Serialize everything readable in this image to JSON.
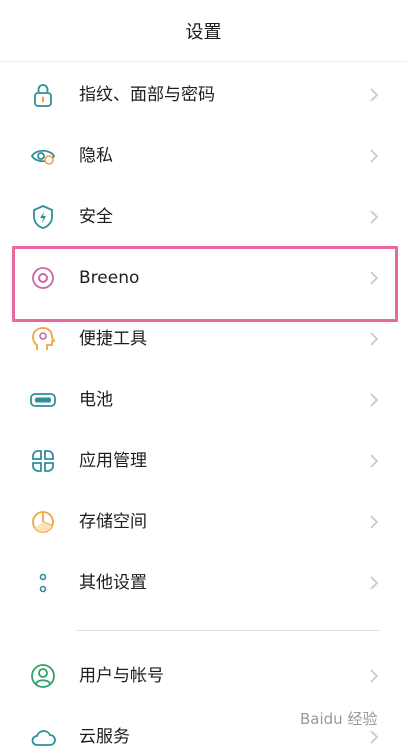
{
  "header": {
    "title": "设置"
  },
  "items": [
    {
      "label": "指纹、面部与密码",
      "icon": "lock-icon"
    },
    {
      "label": "隐私",
      "icon": "privacy-eye-icon"
    },
    {
      "label": "安全",
      "icon": "shield-bolt-icon"
    },
    {
      "label": "Breeno",
      "icon": "breeno-ring-icon"
    },
    {
      "label": "便捷工具",
      "icon": "tools-head-icon"
    },
    {
      "label": "电池",
      "icon": "battery-icon"
    },
    {
      "label": "应用管理",
      "icon": "app-grid-icon"
    },
    {
      "label": "存储空间",
      "icon": "storage-pie-icon"
    },
    {
      "label": "其他设置",
      "icon": "more-dots-icon"
    },
    {
      "label": "用户与帐号",
      "icon": "user-account-icon"
    },
    {
      "label": "云服务",
      "icon": "cloud-icon"
    }
  ],
  "watermark": {
    "text": "Baidu 经验"
  },
  "colors": {
    "icon_stroke": "#2f8e9c",
    "icon_accent_orange": "#f0a440",
    "icon_accent_pink": "#c86aa0",
    "highlight": "#e8679c",
    "chevron": "#c6c6c6"
  }
}
